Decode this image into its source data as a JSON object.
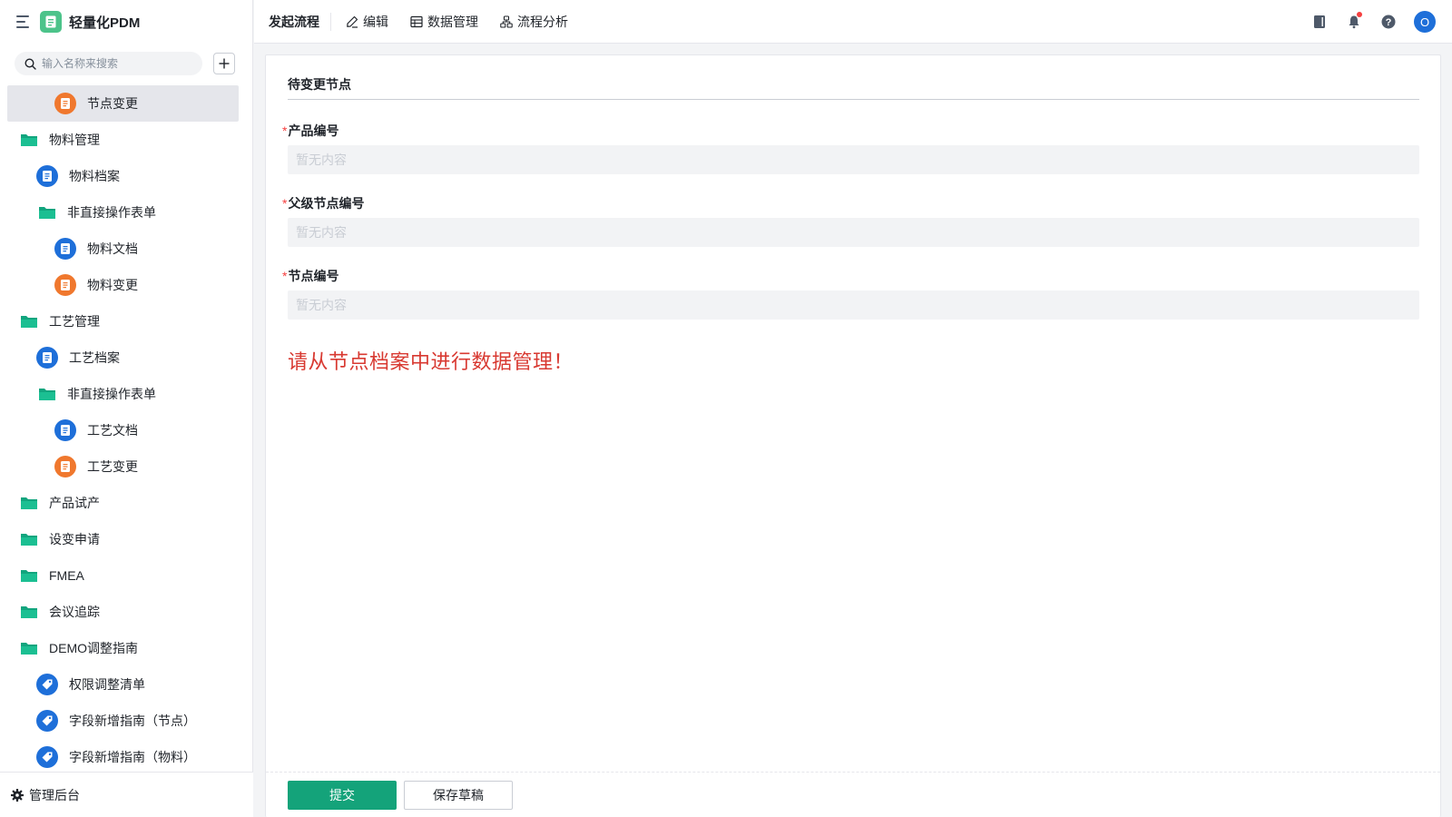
{
  "app": {
    "title": "轻量化PDM"
  },
  "sidebar": {
    "search_placeholder": "输入名称来搜索",
    "items": [
      {
        "label": "节点变更",
        "icon": "orange-form-icon",
        "indent": 3,
        "active": true
      },
      {
        "label": "物料管理",
        "icon": "folder-icon",
        "indent": 1
      },
      {
        "label": "物料档案",
        "icon": "blue-form-icon",
        "indent": 2
      },
      {
        "label": "非直接操作表单",
        "icon": "folder-icon",
        "indent": 2
      },
      {
        "label": "物料文档",
        "icon": "blue-form-icon",
        "indent": 3
      },
      {
        "label": "物料变更",
        "icon": "orange-form-icon",
        "indent": 3
      },
      {
        "label": "工艺管理",
        "icon": "folder-icon",
        "indent": 1
      },
      {
        "label": "工艺档案",
        "icon": "blue-form-icon",
        "indent": 2
      },
      {
        "label": "非直接操作表单",
        "icon": "folder-icon",
        "indent": 2
      },
      {
        "label": "工艺文档",
        "icon": "blue-form-icon",
        "indent": 3
      },
      {
        "label": "工艺变更",
        "icon": "orange-form-icon",
        "indent": 3
      },
      {
        "label": "产品试产",
        "icon": "folder-icon",
        "indent": 1
      },
      {
        "label": "设变申请",
        "icon": "folder-icon",
        "indent": 1
      },
      {
        "label": "FMEA",
        "icon": "folder-icon",
        "indent": 1
      },
      {
        "label": "会议追踪",
        "icon": "folder-icon",
        "indent": 1
      },
      {
        "label": "DEMO调整指南",
        "icon": "folder-icon",
        "indent": 1
      },
      {
        "label": "权限调整清单",
        "icon": "tag-icon",
        "indent": 2
      },
      {
        "label": "字段新增指南（节点）",
        "icon": "tag-icon",
        "indent": 2
      },
      {
        "label": "字段新增指南（物料）",
        "icon": "tag-icon",
        "indent": 2
      }
    ],
    "footer_label": "管理后台"
  },
  "topbar": {
    "tabs": [
      {
        "label": "发起流程",
        "icon": ""
      },
      {
        "label": "编辑",
        "icon": "pencil-icon"
      },
      {
        "label": "数据管理",
        "icon": "table-icon"
      },
      {
        "label": "流程分析",
        "icon": "flow-icon"
      }
    ],
    "avatar_letter": "O"
  },
  "form": {
    "section_title": "待变更节点",
    "fields": [
      {
        "label": "产品编号",
        "required": true,
        "value": "暂无内容"
      },
      {
        "label": "父级节点编号",
        "required": true,
        "value": "暂无内容"
      },
      {
        "label": "节点编号",
        "required": true,
        "value": "暂无内容"
      }
    ],
    "warning": "请从节点档案中进行数据管理！",
    "submit_label": "提交",
    "draft_label": "保存草稿"
  },
  "colors": {
    "primary": "#14a37a",
    "warning_text": "#d83931",
    "blue_icon": "#1e6fd9",
    "orange_icon": "#f0782e",
    "folder": "#12a57e",
    "notification_dot": "#f53f3f"
  }
}
